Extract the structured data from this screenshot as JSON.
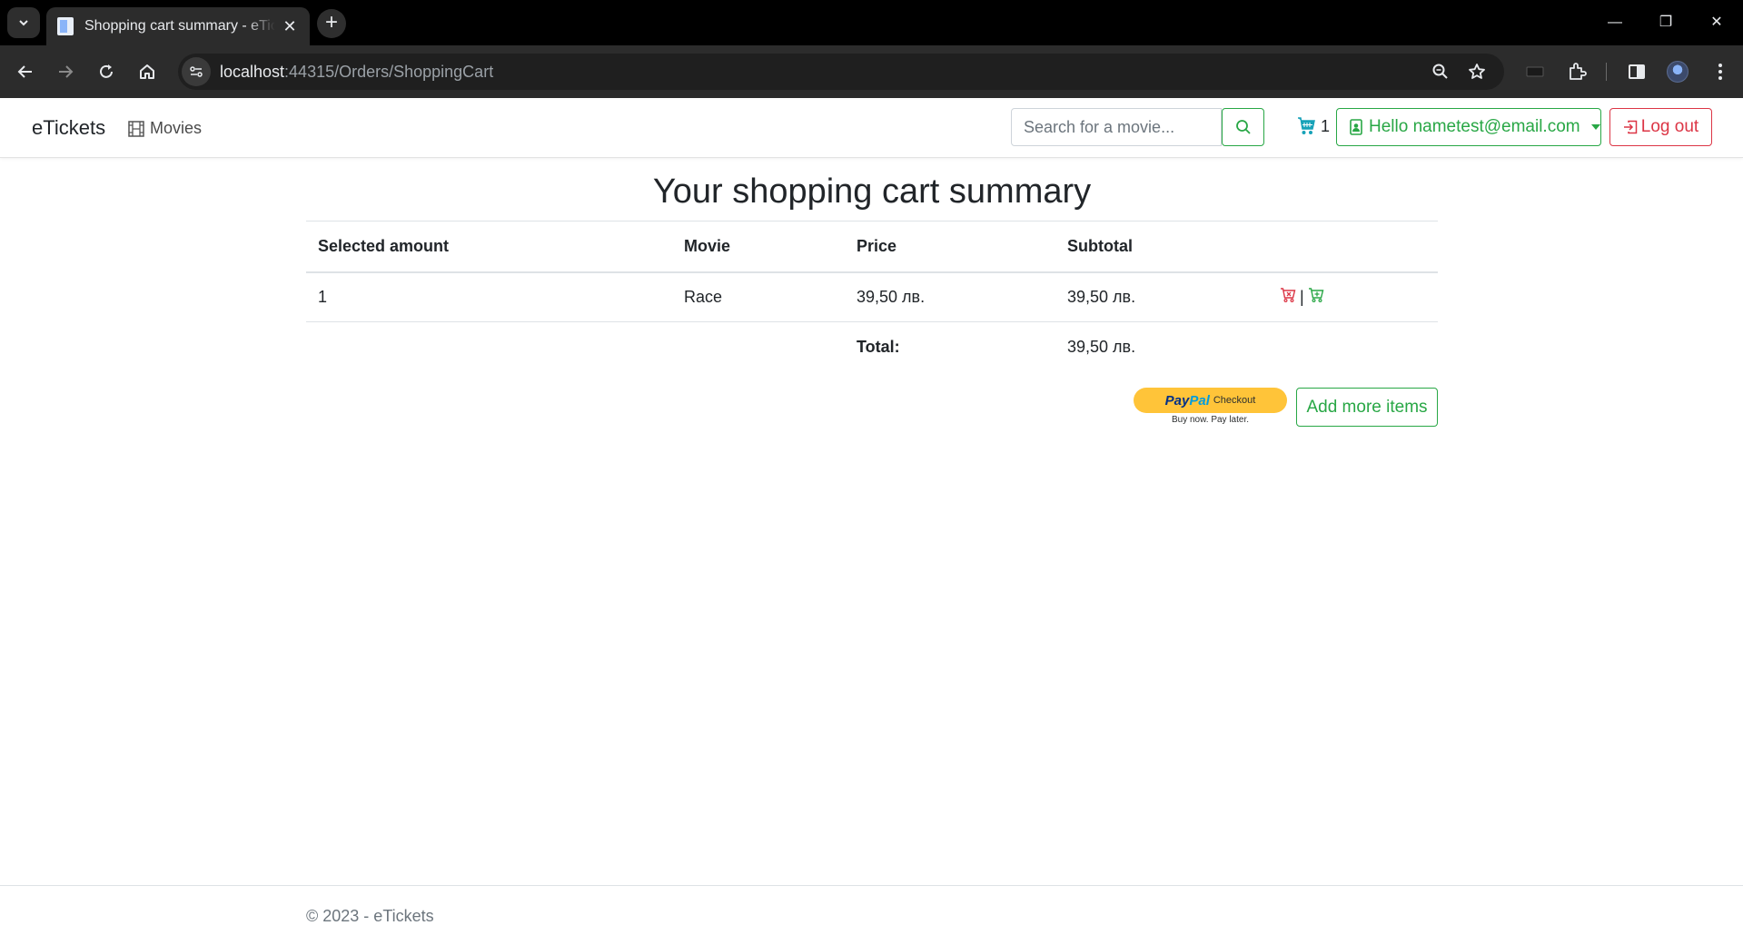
{
  "browser": {
    "tab_title": "Shopping cart summary - eTickets",
    "tab_close": "✕",
    "new_tab": "+",
    "url_host": "localhost",
    "url_path": ":44315/Orders/ShoppingCart",
    "window_controls": {
      "minimize": "—",
      "restore": "❐",
      "close": "✕"
    }
  },
  "navbar": {
    "brand": "eTickets",
    "movies_label": "Movies",
    "search_placeholder": "Search for a movie...",
    "cart_count": "1",
    "hello_label": "Hello nametest@email.com",
    "logout_label": "Log out"
  },
  "main": {
    "title": "Your shopping cart summary",
    "columns": [
      "Selected amount",
      "Movie",
      "Price",
      "Subtotal"
    ],
    "rows": [
      {
        "amount": "1",
        "movie": "Race",
        "price": "39,50 лв.",
        "subtotal": "39,50 лв."
      }
    ],
    "action_separator": "|",
    "total_label": "Total:",
    "total_value": "39,50 лв.",
    "paypal": {
      "logo_dark": "Pay",
      "logo_light": "Pal",
      "checkout": "Checkout",
      "tagline": "Buy now. Pay later."
    },
    "add_more_label": "Add more items"
  },
  "footer": {
    "text": "© 2023 - eTickets"
  },
  "colors": {
    "success": "#28a745",
    "danger": "#dc3545",
    "info": "#17a2b8",
    "paypal_yellow": "#ffc439"
  },
  "icons": [
    "dropdown-icon",
    "favicon",
    "back-arrow-icon",
    "forward-arrow-icon",
    "reload-icon",
    "home-icon",
    "site-settings-icon",
    "zoom-icon",
    "star-icon",
    "keyboard-icon",
    "extensions-icon",
    "sidebar-icon",
    "profile-avatar",
    "menu-dots-icon",
    "film-icon",
    "search-icon",
    "cart-icon",
    "user-badge-icon",
    "logout-icon",
    "cart-remove-icon",
    "cart-add-icon"
  ]
}
